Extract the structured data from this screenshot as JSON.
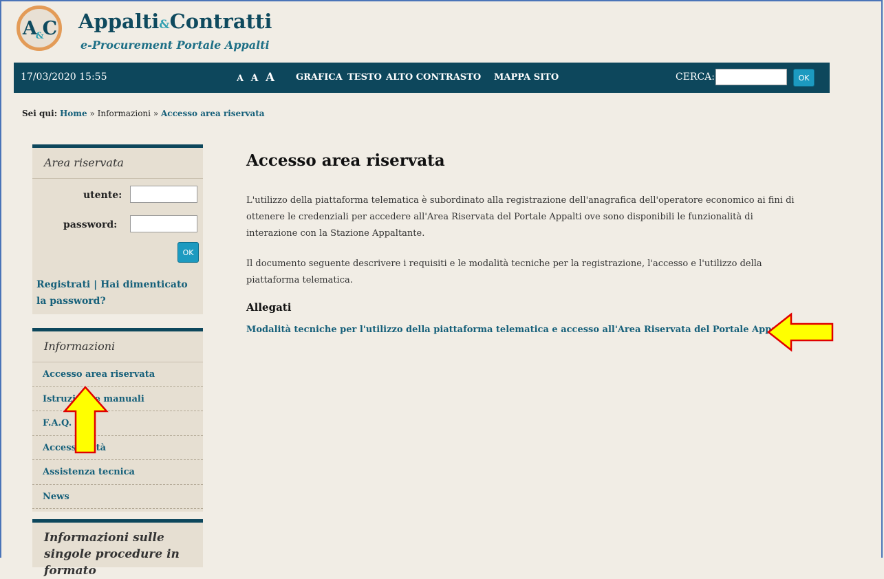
{
  "header": {
    "logo_text": "A&C",
    "title_part1": "Appalti",
    "title_amp": "&",
    "title_part2": "Contratti",
    "subtitle": "e-Procurement Portale Appalti"
  },
  "topbar": {
    "datetime": "17/03/2020 15:55",
    "text_sizes": [
      "A",
      "A",
      "A"
    ],
    "nav": [
      "GRAFICA",
      "TESTO",
      "ALTO CONTRASTO",
      "MAPPA SITO"
    ],
    "search_label": "CERCA:",
    "search_button": "OK",
    "search_value": ""
  },
  "breadcrumb": {
    "label": "Sei qui:",
    "home": "Home",
    "sep1": " » ",
    "middle": "Informazioni",
    "sep2": " » ",
    "current": "Accesso area riservata"
  },
  "login_box": {
    "title": "Area riservata",
    "user_label": "utente:",
    "password_label": "password:",
    "ok_button": "OK",
    "register_link": "Registrati",
    "separator": " | ",
    "forgot_link": "Hai dimenticato la password?"
  },
  "info_box": {
    "title": "Informazioni",
    "items": [
      {
        "label": "Accesso area riservata"
      },
      {
        "label": "Istruzioni e manuali"
      },
      {
        "label": "F.A.Q."
      },
      {
        "label": "Accessibilità"
      },
      {
        "label": "Assistenza tecnica"
      },
      {
        "label": "News"
      }
    ]
  },
  "procedures_box": {
    "title": "Informazioni sulle singole procedure in formato"
  },
  "main": {
    "title": "Accesso area riservata",
    "paragraph1": "L'utilizzo della piattaforma telematica è subordinato alla registrazione dell'anagrafica dell'operatore economico ai fini di ottenere le credenziali per accedere all'Area Riservata del Portale Appalti ove sono disponibili le funzionalità di interazione con la Stazione Appaltante.",
    "paragraph2": "Il documento seguente descrivere i requisiti e le modalità tecniche per la registrazione, l'accesso e l'utilizzo della piattaforma telematica.",
    "attachments_heading": "Allegati",
    "attachment_link": "Modalità tecniche per l'utilizzo della piattaforma telematica e accesso all'Area Riservata del Portale Appalti"
  },
  "colors": {
    "nav_bar": "#0d475c",
    "link": "#16607a",
    "button": "#1c9ac0",
    "sidebar_bg": "#e6dfd2",
    "page_bg": "#f1ede5",
    "arrow_fill": "#ffff00",
    "arrow_border": "#e00000"
  }
}
